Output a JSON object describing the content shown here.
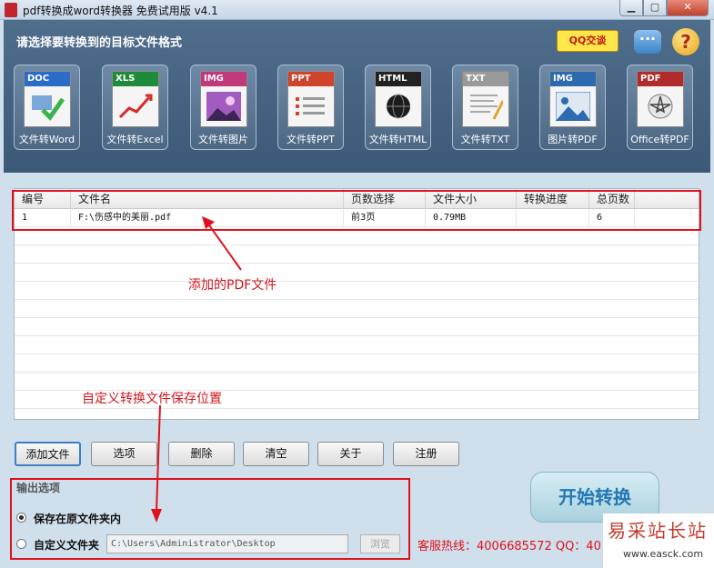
{
  "window": {
    "title": "pdf转换成word转换器 免费试用版 v4.1",
    "min_icon": "minimize-icon",
    "max_icon": "maximize-icon",
    "close_icon": "close-icon",
    "min_glyph": "▁",
    "max_glyph": "▢",
    "close_glyph": "✕"
  },
  "header": {
    "title": "请选择要转换到的目标文件格式",
    "qq_label": "QQ交谈",
    "chat_glyph": "···",
    "help_glyph": "?"
  },
  "tools": [
    {
      "tag": "DOC",
      "label": "文件转Word",
      "color": "#2a6cc7"
    },
    {
      "tag": "XLS",
      "label": "文件转Excel",
      "color": "#1f8b3a"
    },
    {
      "tag": "IMG",
      "label": "文件转图片",
      "color": "#c0397a"
    },
    {
      "tag": "PPT",
      "label": "文件转PPT",
      "color": "#d0442c"
    },
    {
      "tag": "HTML",
      "label": "文件转HTML",
      "color": "#222222"
    },
    {
      "tag": "TXT",
      "label": "文件转TXT",
      "color": "#9a9a9a"
    },
    {
      "tag": "IMG",
      "label": "图片转PDF",
      "color": "#2c6bb0"
    },
    {
      "tag": "PDF",
      "label": "Office转PDF",
      "color": "#b12b2b"
    }
  ],
  "table": {
    "columns": [
      "编号",
      "文件名",
      "页数选择",
      "文件大小",
      "转换进度",
      "总页数"
    ],
    "rows": [
      [
        "1",
        "F:\\伤感中的美丽.pdf",
        "前3页",
        "0.79MB",
        "",
        "6"
      ]
    ]
  },
  "annotations": {
    "pdf_added": "添加的PDF文件",
    "save_location": "自定义转换文件保存位置"
  },
  "buttons": {
    "add_file": "添加文件",
    "options": "选项",
    "delete": "删除",
    "clear": "清空",
    "about": "关于",
    "register": "注册"
  },
  "output": {
    "title": "输出选项",
    "keep_original": "保存在原文件夹内",
    "custom_folder": "自定义文件夹",
    "path": "C:\\Users\\Administrator\\Desktop",
    "browse": "浏览"
  },
  "start_button": "开始转换",
  "hotline": "客服热线：4006685572 QQ：40",
  "watermark": {
    "cn": "易采站长站",
    "url": "www.easck.com"
  }
}
